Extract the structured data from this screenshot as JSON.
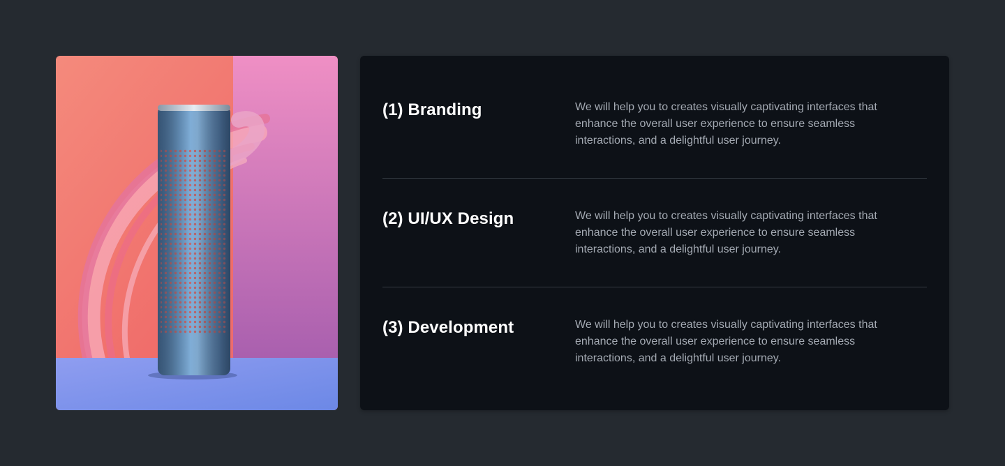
{
  "product_image": {
    "alt": "Cylindrical metallic speaker on a pink and purple background"
  },
  "colors": {
    "page_background": "#252a30",
    "panel_background": "#0d1117",
    "title": "#ffffff",
    "description": "#a4aab3",
    "divider": "#353b43"
  },
  "services": [
    {
      "title": "(1) Branding",
      "description": "We will help you to creates visually captivating interfaces that enhance the overall user experience to ensure seamless interactions, and a delightful user journey."
    },
    {
      "title": "(2) UI/UX Design",
      "description": "We will help you to creates visually captivating interfaces that enhance the overall user experience to ensure seamless interactions, and a delightful user journey."
    },
    {
      "title": "(3) Development",
      "description": "We will help you to creates visually captivating interfaces that enhance the overall user experience to ensure seamless interactions, and a delightful user journey."
    }
  ]
}
